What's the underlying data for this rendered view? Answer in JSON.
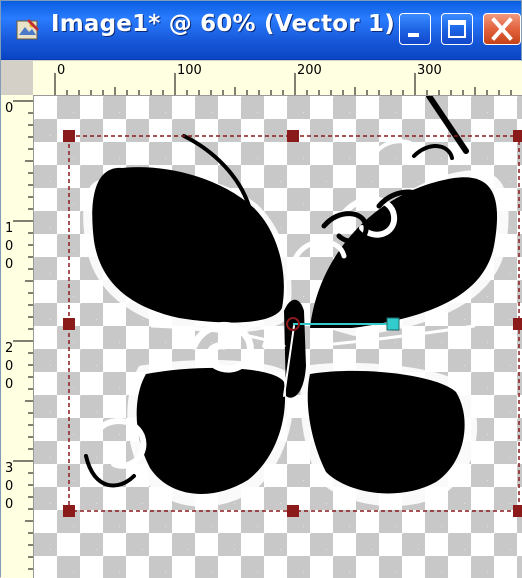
{
  "window": {
    "title": "Image1* @  60% (Vector 1)",
    "title_color": "#ffffff",
    "titlebar_color": "#1657d7",
    "buttons": {
      "minimize_icon": "minimize-icon",
      "maximize_icon": "maximize-icon",
      "close_icon": "close-icon"
    }
  },
  "rulers": {
    "top_labels": [
      "0",
      "100",
      "200",
      "300"
    ],
    "left_labels": [
      "0",
      "1",
      "0",
      "0",
      "2",
      "0",
      "0",
      "3",
      "0",
      "0"
    ]
  },
  "canvas": {
    "zoom": "60%",
    "layer": "Vector 1",
    "selection_color": "#8b1a1a",
    "handle_color": "#33cccc"
  }
}
